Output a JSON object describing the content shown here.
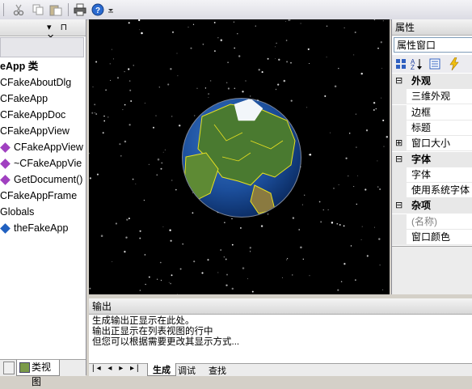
{
  "toolbar": {
    "icons": [
      "cut-icon",
      "copy-icon",
      "paste-icon",
      "print-icon",
      "help-icon",
      "overflow-chevron-icon"
    ]
  },
  "classview": {
    "header_pin": "▾ ⊓ ✕",
    "items": [
      {
        "label": "eApp 类",
        "bold": true,
        "icon": "none"
      },
      {
        "label": "CFakeAboutDlg",
        "icon": "none"
      },
      {
        "label": "CFakeApp",
        "icon": "none"
      },
      {
        "label": "CFakeAppDoc",
        "icon": "none"
      },
      {
        "label": "CFakeAppView",
        "icon": "none"
      },
      {
        "label": "CFakeAppView",
        "icon": "method-icon"
      },
      {
        "label": "~CFakeAppVie",
        "icon": "method-icon"
      },
      {
        "label": "GetDocument()",
        "icon": "method-icon"
      },
      {
        "label": "CFakeAppFrame",
        "icon": "none"
      },
      {
        "label": "Globals",
        "icon": "none"
      },
      {
        "label": "theFakeApp",
        "icon": "variable-icon"
      }
    ],
    "tab_label": "类视图"
  },
  "output": {
    "title": "输出",
    "lines": [
      "生成输出正显示在此处。",
      "输出正显示在列表视图的行中",
      "但您可以根据需要更改其显示方式..."
    ],
    "nav": "|◂ ◂ ▸ ▸|",
    "tabs": [
      "生成",
      "调试",
      "查找"
    ]
  },
  "properties": {
    "title": "属性",
    "combo_value": "属性窗口",
    "rows": [
      {
        "type": "category",
        "expander": "⊟",
        "label": "外观"
      },
      {
        "type": "prop",
        "label": "三维外观"
      },
      {
        "type": "prop",
        "label": "边框"
      },
      {
        "type": "prop",
        "label": "标题"
      },
      {
        "type": "category-collapsed",
        "expander": "⊞",
        "label": "窗口大小"
      },
      {
        "type": "category",
        "expander": "⊟",
        "label": "字体"
      },
      {
        "type": "prop",
        "label": "字体"
      },
      {
        "type": "prop",
        "label": "使用系统字体"
      },
      {
        "type": "category",
        "expander": "⊟",
        "label": "杂项"
      },
      {
        "type": "prop",
        "label": "(名称)",
        "greyed": true
      },
      {
        "type": "prop",
        "label": "窗口颜色"
      }
    ]
  },
  "colors": {
    "method": "#a040c0",
    "variable": "#2060c0",
    "globe_ocean": "#1c4f9c",
    "globe_land": "#4a7a30",
    "globe_border": "#e8e020"
  }
}
